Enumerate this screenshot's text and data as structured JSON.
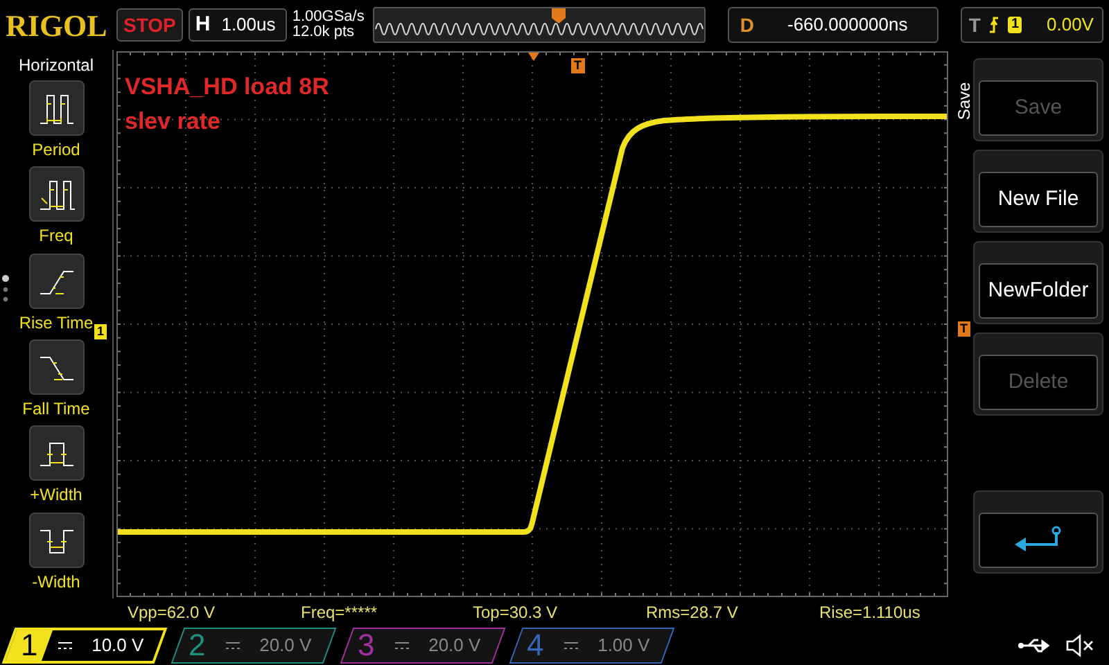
{
  "header": {
    "logo": "RIGOL",
    "run_state": "STOP",
    "timebase": {
      "label": "H",
      "value": "1.00us"
    },
    "sample_rate": "1.00GSa/s",
    "memory_depth": "12.0k pts",
    "delay": {
      "label": "D",
      "value": "-660.000000ns"
    },
    "trigger": {
      "label": "T",
      "source": "1",
      "level": "0.00V"
    }
  },
  "measure_menu": {
    "title": "Horizontal",
    "items": [
      {
        "kind": "period",
        "label": "Period"
      },
      {
        "kind": "freq",
        "label": "Freq"
      },
      {
        "kind": "rise",
        "label": "Rise Time"
      },
      {
        "kind": "fall",
        "label": "Fall Time"
      },
      {
        "kind": "pwidth",
        "label": "+Width"
      },
      {
        "kind": "nwidth",
        "label": "-Width"
      }
    ]
  },
  "annotation": [
    "VSHA_HD load 8R",
    "slev rate"
  ],
  "markers": {
    "trigger_position": "T",
    "channel": "1",
    "trigger_level": "T"
  },
  "softkeys": {
    "title": "Save",
    "buttons": [
      {
        "kind": "text",
        "label": "Save",
        "disabled": true
      },
      {
        "kind": "text",
        "label": "New File",
        "disabled": false
      },
      {
        "kind": "text",
        "label": "NewFolder",
        "disabled": false
      },
      {
        "kind": "text",
        "label": "Delete",
        "disabled": true
      },
      {
        "kind": "return"
      }
    ]
  },
  "measurements": [
    "Vpp=62.0 V",
    "Freq=*****",
    "Top=30.3 V",
    "Rms=28.7 V",
    "Rise=1.110us"
  ],
  "channels": [
    {
      "number": "1",
      "scale": "10.0 V",
      "on": true,
      "color": "#f2e21e"
    },
    {
      "number": "2",
      "scale": "20.0 V",
      "on": false,
      "color": "#1f8f80"
    },
    {
      "number": "3",
      "scale": "20.0 V",
      "on": false,
      "color": "#a3309f"
    },
    {
      "number": "4",
      "scale": "1.00 V",
      "on": false,
      "color": "#3565b8"
    }
  ]
}
